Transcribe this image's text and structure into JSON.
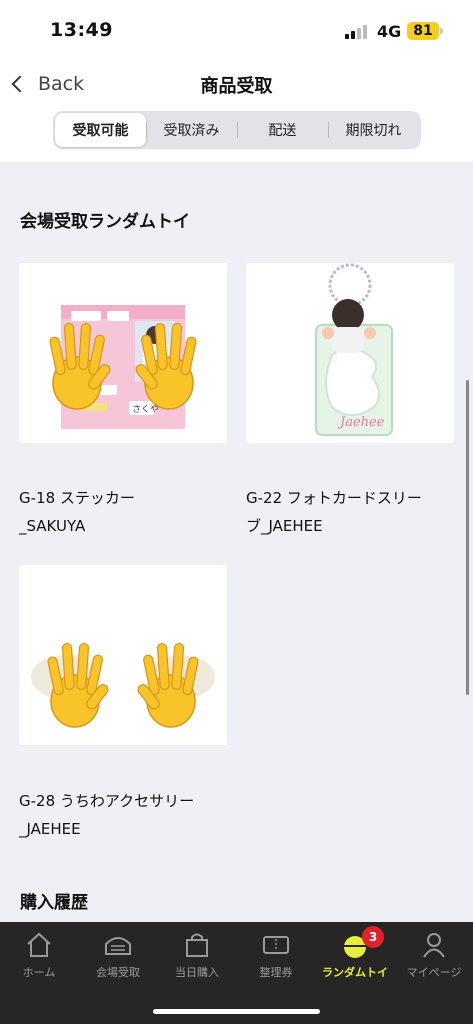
{
  "status": {
    "time": "13:49",
    "network": "4G",
    "battery": "81"
  },
  "nav": {
    "back_label": "Back",
    "title": "商品受取"
  },
  "tabs": [
    {
      "label": "受取可能",
      "active": true
    },
    {
      "label": "受取済み",
      "active": false
    },
    {
      "label": "配送",
      "active": false
    },
    {
      "label": "期限切れ",
      "active": false
    }
  ],
  "section_random_toy": {
    "title": "会場受取ランダムトイ"
  },
  "products": [
    {
      "name_line1": "G-18 ステッカー",
      "name_line2": "_SAKUYA",
      "image": "sticker-sheet",
      "sticker_text": "さくや"
    },
    {
      "name_line1": "G-22 フォトカードスリー",
      "name_line2": "ブ_JAEHEE",
      "image": "photocard-sleeve",
      "script_text": "Jaehee"
    },
    {
      "name_line1": "G-28 うちわアクセサリー",
      "name_line2": "_JAEHEE",
      "image": "uchiwa-accessory"
    }
  ],
  "section_history": {
    "title": "購入履歴"
  },
  "tabbar": {
    "items": [
      {
        "label": "ホーム",
        "icon": "home-icon"
      },
      {
        "label": "会場受取",
        "icon": "venue-icon"
      },
      {
        "label": "当日購入",
        "icon": "bag-icon"
      },
      {
        "label": "整理券",
        "icon": "ticket-icon"
      },
      {
        "label": "ランダムトイ",
        "icon": "random-toy-icon",
        "active": true
      },
      {
        "label": "マイページ",
        "icon": "person-icon"
      }
    ],
    "badge_count": "3",
    "active_color": "#e8ee3c"
  }
}
